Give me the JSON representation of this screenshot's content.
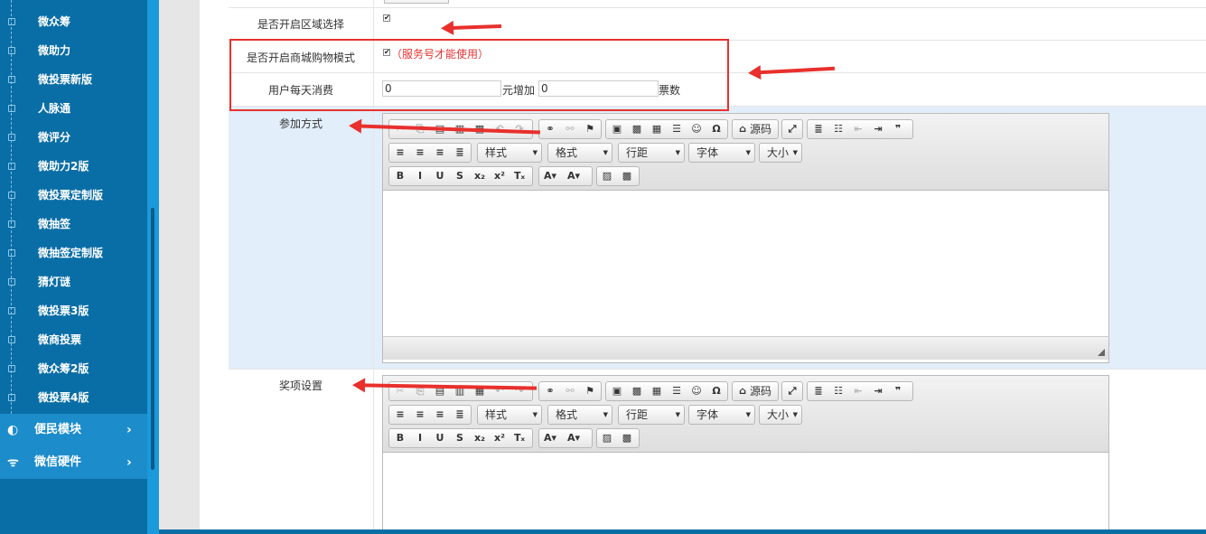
{
  "sidebar": {
    "items": [
      "微众筹",
      "微助力",
      "微投票新版",
      "人脉通",
      "微评分",
      "微助力2版",
      "微投票定制版",
      "微抽签",
      "微抽签定制版",
      "猜灯谜",
      "微投票3版",
      "微商投票",
      "微众筹2版",
      "微投票4版"
    ],
    "modules": [
      {
        "label": "便民模块",
        "icon": "◐",
        "icon_name": "clock-icon",
        "chevron": "›"
      },
      {
        "label": "微信硬件",
        "icon": "ᯤ",
        "icon_name": "router-icon",
        "chevron": "›"
      }
    ]
  },
  "form": {
    "area_select_label": "是否开启区域选择",
    "area_select_checked": true,
    "mall_mode_label": "是否开启商城购物模式",
    "mall_mode_checked": true,
    "mall_mode_note": "（服务号才能使用）",
    "daily_spend_label": "用户每天消费",
    "spend_value": "0",
    "spend_unit": "元增加",
    "votes_value": "0",
    "votes_unit": "票数",
    "join_label": "参加方式",
    "prize_label": "奖项设置"
  },
  "editor": {
    "source_label": "源码",
    "style_label": "样式",
    "format_label": "格式",
    "line_label": "行距",
    "font_label": "字体",
    "size_label": "大小"
  },
  "colors": {
    "sidebar": "#0a6ea6",
    "accent": "#e8302d",
    "band": "#e2eef9"
  }
}
